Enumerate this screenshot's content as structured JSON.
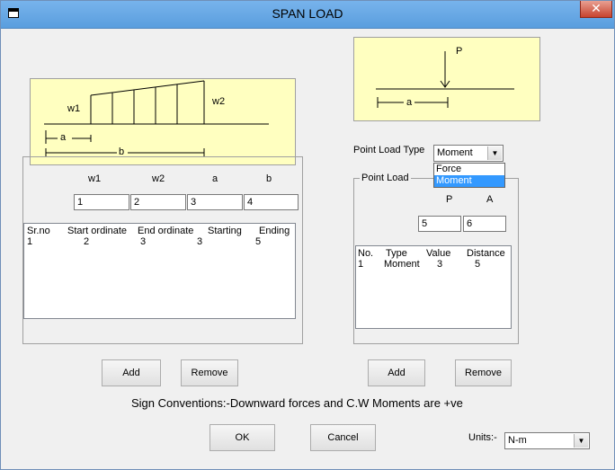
{
  "window": {
    "title": "SPAN LOAD",
    "close_glyph": "✕"
  },
  "udl_diagram": {
    "labels": {
      "w1": "w1",
      "w2": "w2",
      "a": "a",
      "b": "b"
    }
  },
  "point_diagram": {
    "labels": {
      "p": "P",
      "a": "a"
    }
  },
  "udl_fields": {
    "headers": [
      "w1",
      "w2",
      "a",
      "b"
    ],
    "values": [
      "1",
      "2",
      "3",
      "4"
    ]
  },
  "udl_list": {
    "headers": [
      "Sr.no",
      "Start ordinate",
      "End ordinate",
      "Starting",
      "Ending"
    ],
    "rows": [
      [
        "1",
        "2",
        "3",
        "3",
        "5"
      ]
    ]
  },
  "point_load_type": {
    "label": "Point Load Type",
    "selected": "Moment",
    "options": [
      "Force",
      "Moment"
    ],
    "selected_index": 1
  },
  "point_load": {
    "group_title": "Point Load",
    "headers": [
      "P",
      "A"
    ],
    "values": [
      "5",
      "6"
    ],
    "list_headers": [
      "No.",
      "Type",
      "Value",
      "Distance"
    ],
    "rows": [
      [
        "1",
        "Moment",
        "3",
        "5"
      ]
    ]
  },
  "buttons": {
    "add": "Add",
    "remove": "Remove",
    "ok": "OK",
    "cancel": "Cancel"
  },
  "sign_convention": "Sign Conventions:-Downward forces and  C.W Moments are +ve",
  "units": {
    "label": "Units:-",
    "selected": "N-m"
  }
}
